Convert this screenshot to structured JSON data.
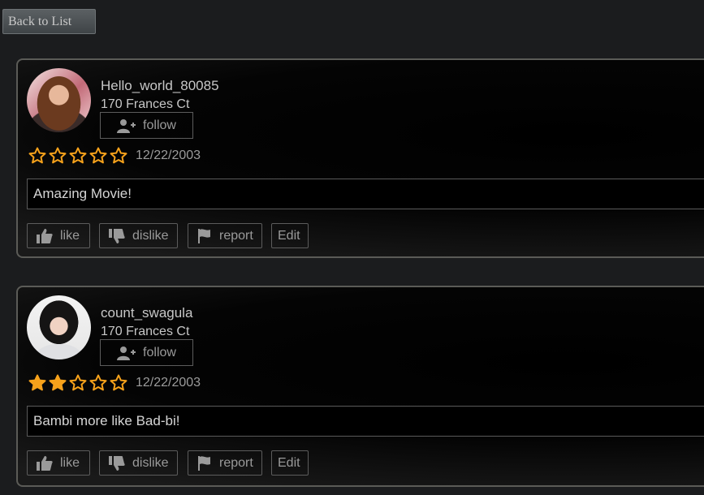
{
  "nav": {
    "back_label": "Back to List"
  },
  "colors": {
    "star_fill": "#f7a21b",
    "star_empty": "#f7a21b",
    "text_muted": "#9a9a9a"
  },
  "reviews": [
    {
      "username": "Hello_world_80085",
      "address": "170 Frances Ct",
      "follow_label": "follow",
      "rating": 0,
      "rating_max": 5,
      "date": "12/22/2003",
      "comment": "Amazing Movie!",
      "actions": {
        "like": "like",
        "dislike": "dislike",
        "report": "report",
        "edit": "Edit"
      }
    },
    {
      "username": "count_swagula",
      "address": "170 Frances Ct",
      "follow_label": "follow",
      "rating": 2,
      "rating_max": 5,
      "date": "12/22/2003",
      "comment": "Bambi more like Bad-bi!",
      "actions": {
        "like": "like",
        "dislike": "dislike",
        "report": "report",
        "edit": "Edit"
      }
    }
  ],
  "icons": {
    "follow": "add-user-icon",
    "like": "thumbs-up-icon",
    "dislike": "thumbs-down-icon",
    "report": "flag-icon",
    "star": "star-icon"
  }
}
